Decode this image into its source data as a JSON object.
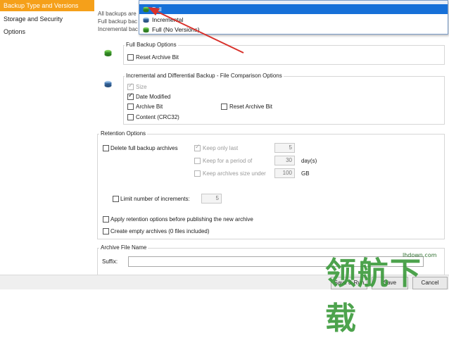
{
  "sidebar": {
    "items": [
      {
        "label": "Backup Type and Versions"
      },
      {
        "label": "Storage and Security"
      },
      {
        "label": "Options"
      }
    ]
  },
  "intro": {
    "line1": "All backups are",
    "line2": "Full backup bac",
    "line3": "Incremental bac"
  },
  "backup_type_dropdown": {
    "options": [
      {
        "label": "Full",
        "icon": "green-disk-icon"
      },
      {
        "label": "Incremental",
        "icon": "blue-disk-icon"
      },
      {
        "label": "Full (No Versions)",
        "icon": "green-disk-icon"
      }
    ],
    "selected": "Full"
  },
  "full_backup_options": {
    "title": "Full Backup Options",
    "reset_archive_bit": "Reset Archive Bit"
  },
  "compare_options": {
    "title": "Incremental and Differential Backup - File Comparison Options",
    "size": "Size",
    "date_modified": "Date Modified",
    "archive_bit": "Archive Bit",
    "reset_archive_bit": "Reset Archive Bit",
    "content": "Content (CRC32)"
  },
  "retention": {
    "title": "Retention Options",
    "delete_full": "Delete full backup archives",
    "keep_only_last": "Keep only last",
    "keep_only_last_value": "5",
    "keep_for_period": "Keep for a period of",
    "keep_for_period_value": "30",
    "keep_for_period_unit": "day(s)",
    "keep_size_under": "Keep archives size under",
    "keep_size_under_value": "100",
    "keep_size_unit": "GB",
    "limit_increments": "Limit number of increments:",
    "limit_increments_value": "5",
    "apply_before_publish": "Apply retention options before publishing the new archive",
    "create_empty": "Create empty archives (0 files included)"
  },
  "archive_file_name": {
    "title": "Archive File Name",
    "suffix_label": "Suffix:",
    "suffix_value": ""
  },
  "buttons": {
    "save_run": "Save & Run",
    "save": "Save",
    "cancel": "Cancel"
  },
  "watermark": {
    "text": "领航下载",
    "url": "lhdown.com"
  },
  "colors": {
    "sidebar_active": "#f5a01a",
    "dropdown_selected": "#1670d8",
    "annotation_arrow": "#d8312b"
  }
}
